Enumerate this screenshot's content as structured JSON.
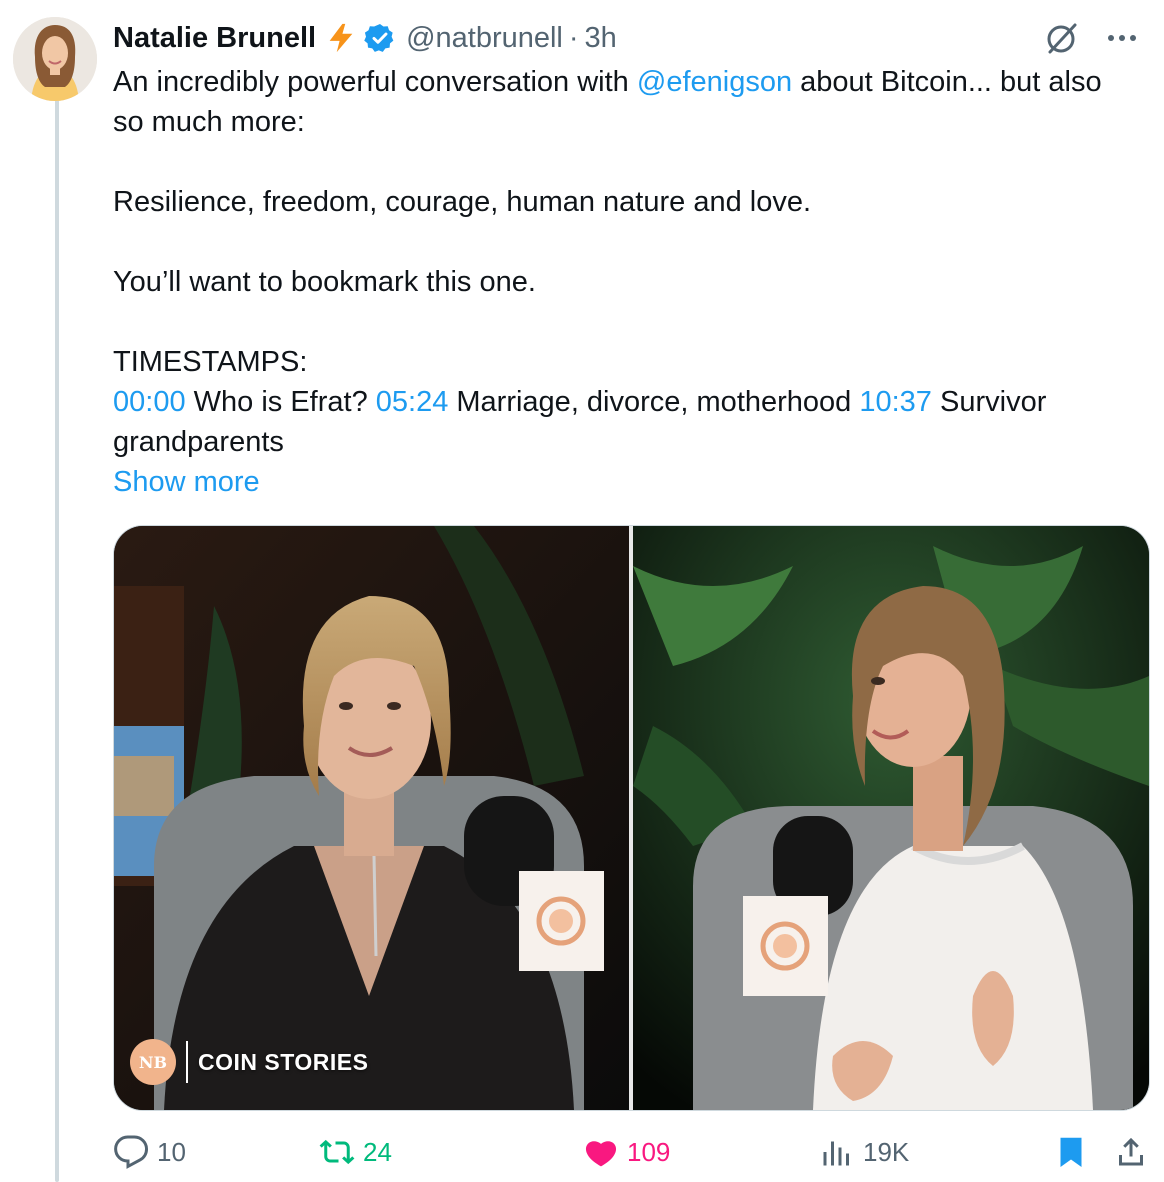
{
  "author": {
    "name": "Natalie Brunell",
    "handle": "@natbrunell",
    "separator": "·",
    "time": "3h"
  },
  "tweet": {
    "line1_pre": "An incredibly powerful conversation with ",
    "mention": "@efenigson",
    "line1_post": " about Bitcoin... but also so much more:",
    "para2": "Resilience, freedom, courage, human nature and love.",
    "para3": "You’ll want to bookmark this one.",
    "para4_heading": "TIMESTAMPS:",
    "ts1": "00:00",
    "ts1_label": " Who is Efrat? ",
    "ts2": "05:24",
    "ts2_label": " Marriage, divorce, motherhood ",
    "ts3": "10:37",
    "ts3_label": " Survivor grandparents",
    "show_more": "Show more"
  },
  "media": {
    "brand_badge": "NB",
    "brand_text": "COIN STORIES"
  },
  "actions": {
    "replies": "10",
    "reposts": "24",
    "likes": "109",
    "views": "19K"
  },
  "colors": {
    "link": "#1d9bf0",
    "repost_active": "#00ba7c",
    "like_active": "#f91880",
    "bookmark_active": "#1d9bf0",
    "muted": "#536471"
  },
  "icons": {
    "bolt": "lightning-bolt-icon",
    "verified": "verified-badge-icon",
    "grok": "grok-icon",
    "more": "more-dots-icon",
    "reply": "reply-icon",
    "repost": "repost-icon",
    "like": "heart-icon",
    "views": "views-icon",
    "bookmark": "bookmark-icon",
    "share": "share-icon"
  }
}
